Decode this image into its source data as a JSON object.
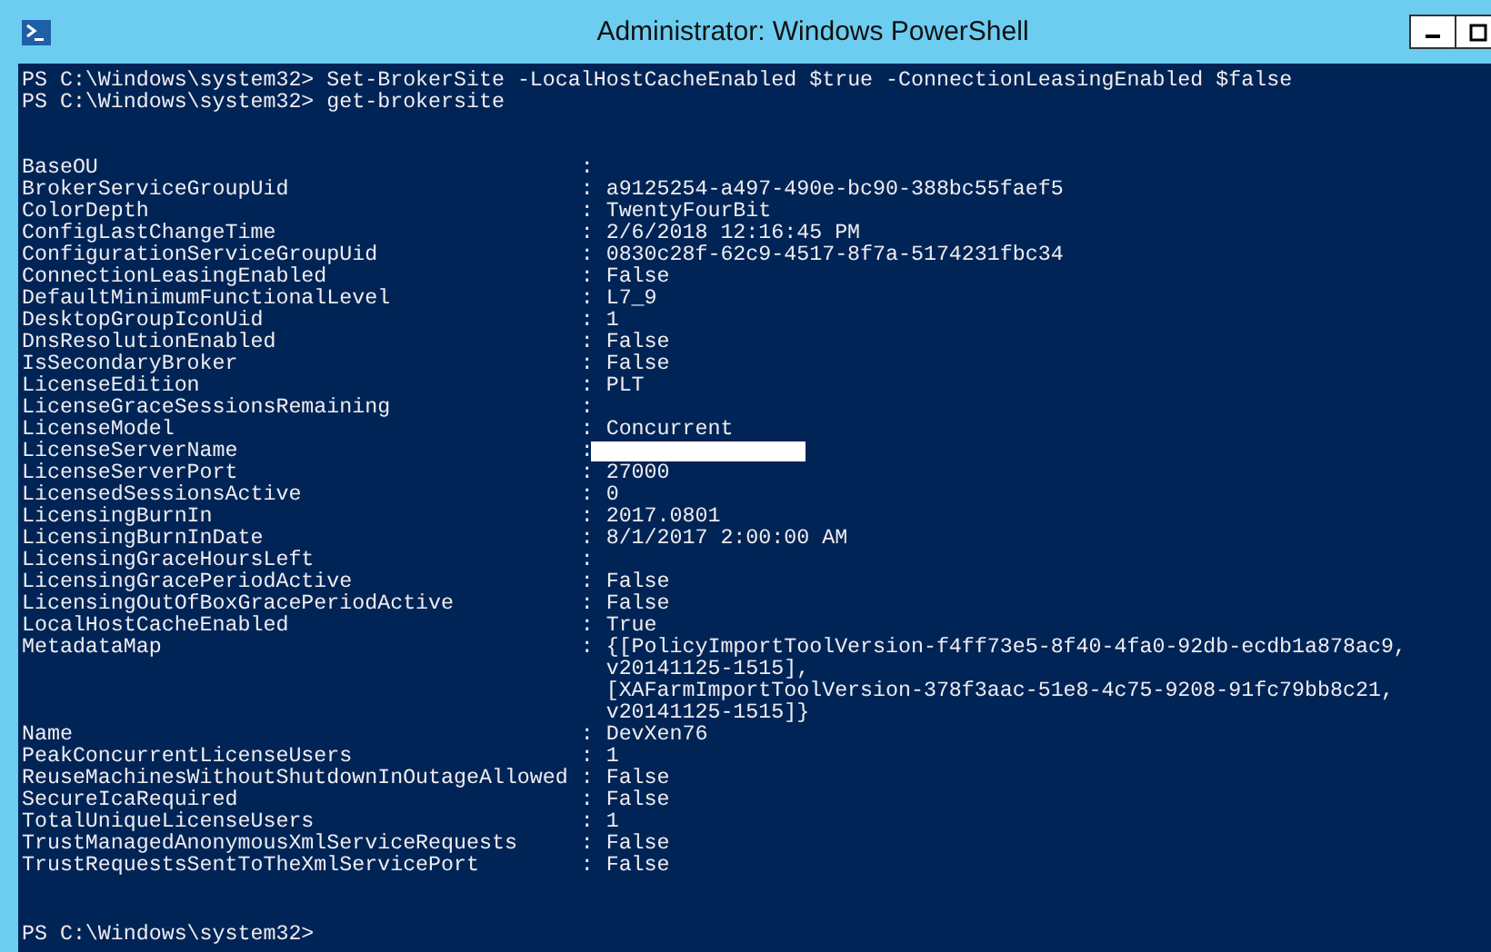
{
  "window": {
    "title": "Administrator: Windows PowerShell"
  },
  "commands": [
    {
      "prompt": "PS C:\\Windows\\system32>",
      "text": "Set-BrokerSite -LocalHostCacheEnabled $true -ConnectionLeasingEnabled $false"
    },
    {
      "prompt": "PS C:\\Windows\\system32>",
      "text": "get-brokersite"
    }
  ],
  "properties": [
    {
      "name": "BaseOU",
      "colon": ":"
    },
    {
      "name": "BrokerServiceGroupUid",
      "colon": ":",
      "value": "a9125254-a497-490e-bc90-388bc55faef5"
    },
    {
      "name": "ColorDepth",
      "colon": ":",
      "value": "TwentyFourBit"
    },
    {
      "name": "ConfigLastChangeTime",
      "colon": ":",
      "value": "2/6/2018 12:16:45 PM"
    },
    {
      "name": "ConfigurationServiceGroupUid",
      "colon": ":",
      "value": "0830c28f-62c9-4517-8f7a-5174231fbc34"
    },
    {
      "name": "ConnectionLeasingEnabled",
      "colon": ":",
      "value": "False"
    },
    {
      "name": "DefaultMinimumFunctionalLevel",
      "colon": ":",
      "value": "L7_9"
    },
    {
      "name": "DesktopGroupIconUid",
      "colon": ":",
      "value": "1"
    },
    {
      "name": "DnsResolutionEnabled",
      "colon": ":",
      "value": "False"
    },
    {
      "name": "IsSecondaryBroker",
      "colon": ":",
      "value": "False"
    },
    {
      "name": "LicenseEdition",
      "colon": ":",
      "value": "PLT"
    },
    {
      "name": "LicenseGraceSessionsRemaining",
      "colon": ":"
    },
    {
      "name": "LicenseModel",
      "colon": ":",
      "value": "Concurrent"
    },
    {
      "name": "LicenseServerName",
      "colon": ":",
      "redacted": true
    },
    {
      "name": "LicenseServerPort",
      "colon": ":",
      "value": "27000"
    },
    {
      "name": "LicensedSessionsActive",
      "colon": ":",
      "value": "0"
    },
    {
      "name": "LicensingBurnIn",
      "colon": ":",
      "value": "2017.0801"
    },
    {
      "name": "LicensingBurnInDate",
      "colon": ":",
      "value": "8/1/2017 2:00:00 AM"
    },
    {
      "name": "LicensingGraceHoursLeft",
      "colon": ":"
    },
    {
      "name": "LicensingGracePeriodActive",
      "colon": ":",
      "value": "False"
    },
    {
      "name": "LicensingOutOfBoxGracePeriodActive",
      "colon": ":",
      "value": "False"
    },
    {
      "name": "LocalHostCacheEnabled",
      "colon": ":",
      "value": "True"
    },
    {
      "name": "MetadataMap",
      "colon": ":",
      "value_lines": [
        "{[PolicyImportToolVersion-f4ff73e5-8f40-4fa0-92db-ecdb1a878ac9,",
        "v20141125-1515],",
        "[XAFarmImportToolVersion-378f3aac-51e8-4c75-9208-91fc79bb8c21,",
        "v20141125-1515]}"
      ]
    },
    {
      "name": "Name",
      "colon": ":",
      "value": "DevXen76"
    },
    {
      "name": "PeakConcurrentLicenseUsers",
      "colon": ":",
      "value": "1"
    },
    {
      "name": "ReuseMachinesWithoutShutdownInOutageAllowed",
      "colon": ":",
      "value": "False"
    },
    {
      "name": "SecureIcaRequired",
      "colon": ":",
      "value": "False"
    },
    {
      "name": "TotalUniqueLicenseUsers",
      "colon": ":",
      "value": "1"
    },
    {
      "name": "TrustManagedAnonymousXmlServiceRequests",
      "colon": ":",
      "value": "False"
    },
    {
      "name": "TrustRequestsSentToTheXmlServicePort",
      "colon": ":",
      "value": "False"
    }
  ],
  "final_prompt": "PS C:\\Windows\\system32>"
}
